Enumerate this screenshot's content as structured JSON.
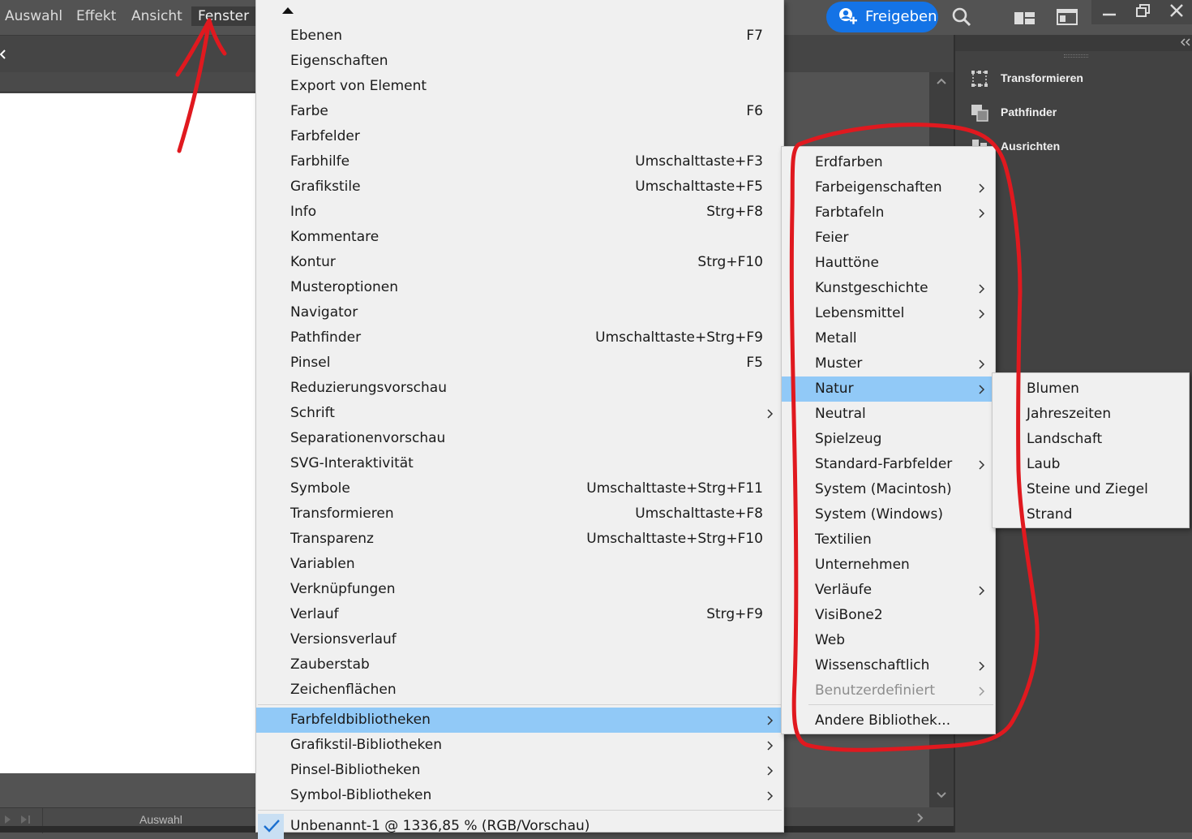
{
  "menubar": {
    "items": [
      "Auswahl",
      "Effekt",
      "Ansicht",
      "Fenster"
    ],
    "active": "Fenster",
    "share_label": "Freigeben"
  },
  "status": {
    "tool_label": "Auswahl"
  },
  "right_panel": {
    "items": [
      {
        "label": "Transformieren",
        "icon": "transform-icon"
      },
      {
        "label": "Pathfinder",
        "icon": "pathfinder-icon"
      },
      {
        "label": "Ausrichten",
        "icon": "align-icon"
      }
    ]
  },
  "window_menu": {
    "items": [
      {
        "label": "Ebenen",
        "shortcut": "F7"
      },
      {
        "label": "Eigenschaften",
        "shortcut": ""
      },
      {
        "label": "Export von Element",
        "shortcut": ""
      },
      {
        "label": "Farbe",
        "shortcut": "F6"
      },
      {
        "label": "Farbfelder",
        "shortcut": ""
      },
      {
        "label": "Farbhilfe",
        "shortcut": "Umschalttaste+F3"
      },
      {
        "label": "Grafikstile",
        "shortcut": "Umschalttaste+F5"
      },
      {
        "label": "Info",
        "shortcut": "Strg+F8"
      },
      {
        "label": "Kommentare",
        "shortcut": ""
      },
      {
        "label": "Kontur",
        "shortcut": "Strg+F10"
      },
      {
        "label": "Musteroptionen",
        "shortcut": ""
      },
      {
        "label": "Navigator",
        "shortcut": ""
      },
      {
        "label": "Pathfinder",
        "shortcut": "Umschalttaste+Strg+F9"
      },
      {
        "label": "Pinsel",
        "shortcut": "F5"
      },
      {
        "label": "Reduzierungsvorschau",
        "shortcut": ""
      },
      {
        "label": "Schrift",
        "shortcut": "",
        "submenu": true
      },
      {
        "label": "Separationenvorschau",
        "shortcut": ""
      },
      {
        "label": "SVG-Interaktivität",
        "shortcut": ""
      },
      {
        "label": "Symbole",
        "shortcut": "Umschalttaste+Strg+F11"
      },
      {
        "label": "Transformieren",
        "shortcut": "Umschalttaste+F8"
      },
      {
        "label": "Transparenz",
        "shortcut": "Umschalttaste+Strg+F10"
      },
      {
        "label": "Variablen",
        "shortcut": ""
      },
      {
        "label": "Verknüpfungen",
        "shortcut": ""
      },
      {
        "label": "Verlauf",
        "shortcut": "Strg+F9"
      },
      {
        "label": "Versionsverlauf",
        "shortcut": ""
      },
      {
        "label": "Zauberstab",
        "shortcut": ""
      },
      {
        "label": "Zeichenflächen",
        "shortcut": ""
      }
    ],
    "library_items": [
      {
        "label": "Farbfeldbibliotheken",
        "submenu": true,
        "highlighted": true
      },
      {
        "label": "Grafikstil-Bibliotheken",
        "submenu": true
      },
      {
        "label": "Pinsel-Bibliotheken",
        "submenu": true
      },
      {
        "label": "Symbol-Bibliotheken",
        "submenu": true
      }
    ],
    "document_item": "Unbenannt-1 @ 1336,85 % (RGB/Vorschau)"
  },
  "swatch_libraries": {
    "items": [
      {
        "label": "Erdfarben"
      },
      {
        "label": "Farbeigenschaften",
        "submenu": true
      },
      {
        "label": "Farbtafeln",
        "submenu": true
      },
      {
        "label": "Feier"
      },
      {
        "label": "Hauttöne"
      },
      {
        "label": "Kunstgeschichte",
        "submenu": true
      },
      {
        "label": "Lebensmittel",
        "submenu": true
      },
      {
        "label": "Metall"
      },
      {
        "label": "Muster",
        "submenu": true
      },
      {
        "label": "Natur",
        "submenu": true,
        "highlighted": true
      },
      {
        "label": "Neutral"
      },
      {
        "label": "Spielzeug"
      },
      {
        "label": "Standard-Farbfelder",
        "submenu": true
      },
      {
        "label": "System (Macintosh)"
      },
      {
        "label": "System (Windows)"
      },
      {
        "label": "Textilien"
      },
      {
        "label": "Unternehmen"
      },
      {
        "label": "Verläufe",
        "submenu": true
      },
      {
        "label": "VisiBone2"
      },
      {
        "label": "Web"
      },
      {
        "label": "Wissenschaftlich",
        "submenu": true
      },
      {
        "label": "Benutzerdefiniert",
        "submenu": true,
        "disabled": true
      }
    ],
    "other_label": "Andere Bibliothek..."
  },
  "nature_submenu": {
    "items": [
      "Blumen",
      "Jahreszeiten",
      "Landschaft",
      "Laub",
      "Steine und Ziegel",
      "Strand"
    ]
  },
  "colors": {
    "app_bg": "#535353",
    "menu_bg": "#f0f0f0",
    "highlight": "#91c9f7",
    "accent": "#1473e6",
    "annotation": "#e0191f"
  }
}
